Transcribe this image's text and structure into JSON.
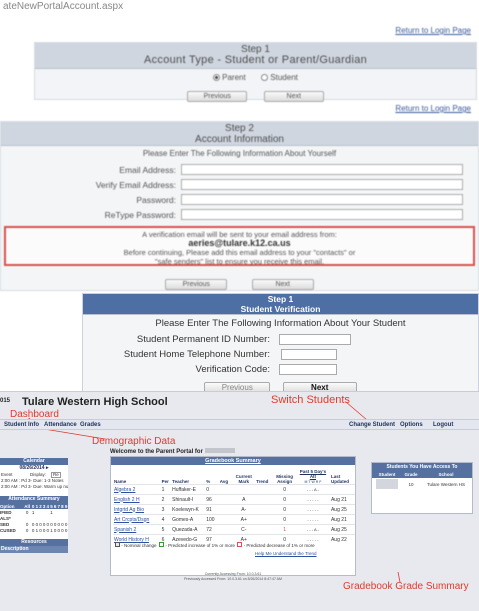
{
  "address_bar": "ateNewPortalAccount.aspx",
  "colors": {
    "annotation": "#e23a2e",
    "header_blue": "#5671a0",
    "panel_gray": "#cfd6e0",
    "alert_red": "#d9534f"
  },
  "step1_account": {
    "return_link": "Return to Login Page",
    "title": "Step 1",
    "subtitle": "Account Type - Student or Parent/Guardian",
    "options": [
      "Parent",
      "Student"
    ],
    "selected": "Parent",
    "prev": "Previous",
    "next": "Next"
  },
  "step2_info": {
    "return_link": "Return to Login Page",
    "title": "Step 2",
    "subtitle": "Account Information",
    "intro": "Please Enter The Following Information About Yourself",
    "fields": [
      "Email Address:",
      "Verify Email Address:",
      "Password:",
      "ReType Password:"
    ],
    "notice_line1": "A verification email will be sent to your email address from:",
    "notice_email": "aeries@tulare.k12.ca.us",
    "notice_line2": "Before continuing, Please add this email address to your \"contacts\" or",
    "notice_line3": "\"safe senders\" list to ensure you receive this email.",
    "prev": "Previous",
    "next": "Next"
  },
  "student_verify": {
    "title": "Step 1",
    "subtitle": "Student Verification",
    "intro": "Please Enter The Following Information About Your Student",
    "fields": [
      "Student Permanent ID Number:",
      "Student Home Telephone Number:",
      "Verification Code:"
    ],
    "prev": "Previous",
    "next": "Next"
  },
  "portal": {
    "year_stub": "015",
    "school": "Tulare Western High School",
    "nav": {
      "student_info": "Student Info",
      "attendance": "Attendance",
      "grades": "Grades",
      "change_student": "Change Student",
      "options": "Options",
      "logout": "Logout"
    },
    "welcome": "Welcome to the Parent Portal for",
    "annotations": {
      "dashboard": "Dashboard",
      "switch": "Switch Students",
      "demographic": "Demographic Data",
      "gradebook": "Gradebook Grade Summary"
    },
    "calendar": {
      "title": "Calendar",
      "date": "08/26/2014",
      "event_label": "Event",
      "display_label": "Display:",
      "display_value": "Re",
      "events": [
        "2:00 AM : Pd 3- Due: 1-3 Notes",
        "2:00 AM : Pd 3- Due: Warm up number 2"
      ]
    },
    "attendance": {
      "title": "Attendance Summary",
      "header": [
        "Option",
        "All",
        "0",
        "1",
        "2",
        "3",
        "4",
        "5",
        "6",
        "7",
        "8",
        "9"
      ],
      "rows": [
        [
          "IFIED",
          "0",
          "1",
          "",
          "",
          "",
          "",
          "1",
          "",
          "",
          "",
          ""
        ],
        [
          "ALS*",
          "",
          "",
          "",
          "",
          "",
          "",
          "",
          "",
          "",
          "",
          ""
        ],
        [
          "SED",
          "0",
          "0",
          "0",
          "0",
          "0",
          "0",
          "0",
          "0",
          "0",
          "0",
          "0"
        ],
        [
          "CUSED",
          "0",
          "0",
          "1",
          "0",
          "0",
          "0",
          "1",
          "0",
          "0",
          "0",
          "0"
        ]
      ]
    },
    "resources": {
      "title": "Resources",
      "description": "Description"
    },
    "gradebook": {
      "title": "Gradebook Summary",
      "columns": [
        "Name",
        "Per",
        "Teacher",
        "%",
        "Avg",
        "Current Mark",
        "Trend",
        "Missing Assign",
        "Past 5 Day's Att",
        "Last Updated"
      ],
      "att_days": "M T W R F",
      "rows": [
        [
          "Algebra 2",
          "1",
          "Huffaker-E",
          "0",
          "",
          "",
          "",
          "0",
          "- - - A -",
          ""
        ],
        [
          "English 2 H",
          "2",
          "Shinault-I",
          "96",
          "",
          "A",
          "",
          "0",
          "- - - - -",
          "Aug 21"
        ],
        [
          "Intgrtd Ag Bio",
          "3",
          "Koelewyn-K",
          "91",
          "",
          "A-",
          "",
          "0",
          "- - - - -",
          "Aug 25"
        ],
        [
          "Art Crcpts/Dsgn",
          "4",
          "Gomes-A",
          "100",
          "",
          "A+",
          "",
          "0",
          "- - - - -",
          "Aug 21"
        ],
        [
          "Spanish 2",
          "5",
          "Quezada-A",
          "72",
          "",
          "C-",
          "",
          "1",
          "- - - A -",
          "Aug 25"
        ],
        [
          "World History H",
          "6",
          "Azevedo-G",
          "97",
          "",
          "A+",
          "",
          "0",
          "- - - - -",
          "Aug 22"
        ]
      ],
      "legend_nominal": "- Nominal change",
      "legend_increase": "- Predicted increase of 1% or more",
      "legend_decrease": "- Predicted decrease of 1% or more",
      "help_link": "Help Me Understand the Trend"
    },
    "students": {
      "title": "Students You Have Access To",
      "columns": [
        "Student",
        "Grade",
        "School"
      ],
      "grade": "10",
      "school": "Tulare Western HS"
    },
    "footer": [
      "Currently Accessing From: 10.0.3.61",
      "Previously Accessed From: 10.0.3.61 on 8/26/2014 8:47:47 AM"
    ]
  }
}
